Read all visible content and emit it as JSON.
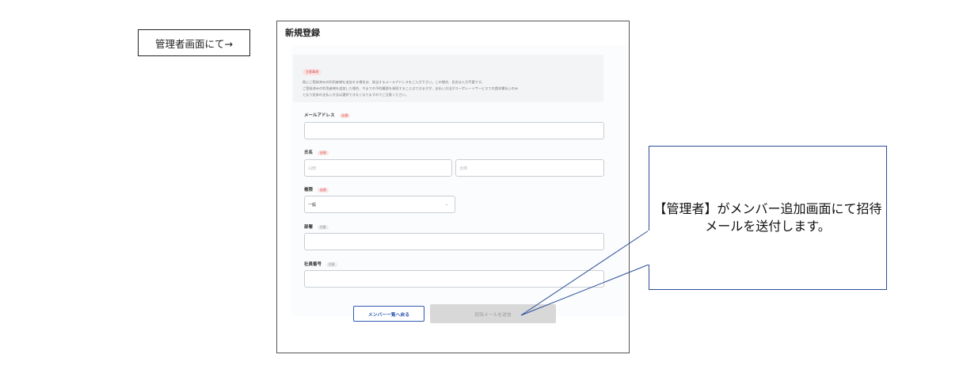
{
  "side_label": "管理者画面にて→",
  "screen": {
    "title": "新規登録",
    "notice": {
      "tag": "注意事項",
      "lines": [
        "既にご登録済みの利用者様を追加する場合は、該当するメールアドレスをご入力下さい。この場合、氏名は入力不要です。",
        "ご登録済みの利用者様を追加した場合、今までの予約履歴を参照することはできますが、支払い方法がコーポレートサービスでの請求書払いのみ",
        "となり従来の支払い方法は選択できなくなりますのでご注意ください。"
      ]
    },
    "form": {
      "email": {
        "label": "メールアドレス",
        "badge": "必須",
        "value": ""
      },
      "name": {
        "label": "氏名",
        "badge": "必須",
        "last_placeholder": "山田",
        "first_placeholder": "太郎"
      },
      "role": {
        "label": "権限",
        "badge": "必須",
        "value": "一般"
      },
      "department": {
        "label": "部署",
        "badge": "任意",
        "value": ""
      },
      "employee_no": {
        "label": "社員番号",
        "badge": "任意",
        "value": ""
      }
    },
    "buttons": {
      "back": "メンバー一覧へ戻る",
      "send": "招待メールを送信"
    }
  },
  "callout": {
    "text": "【管理者】がメンバー追加画面にて招待メールを送付します。"
  },
  "colors": {
    "accent": "#2f5ab0",
    "required": "#d24b4b",
    "callout_border": "#2a4f9a"
  }
}
